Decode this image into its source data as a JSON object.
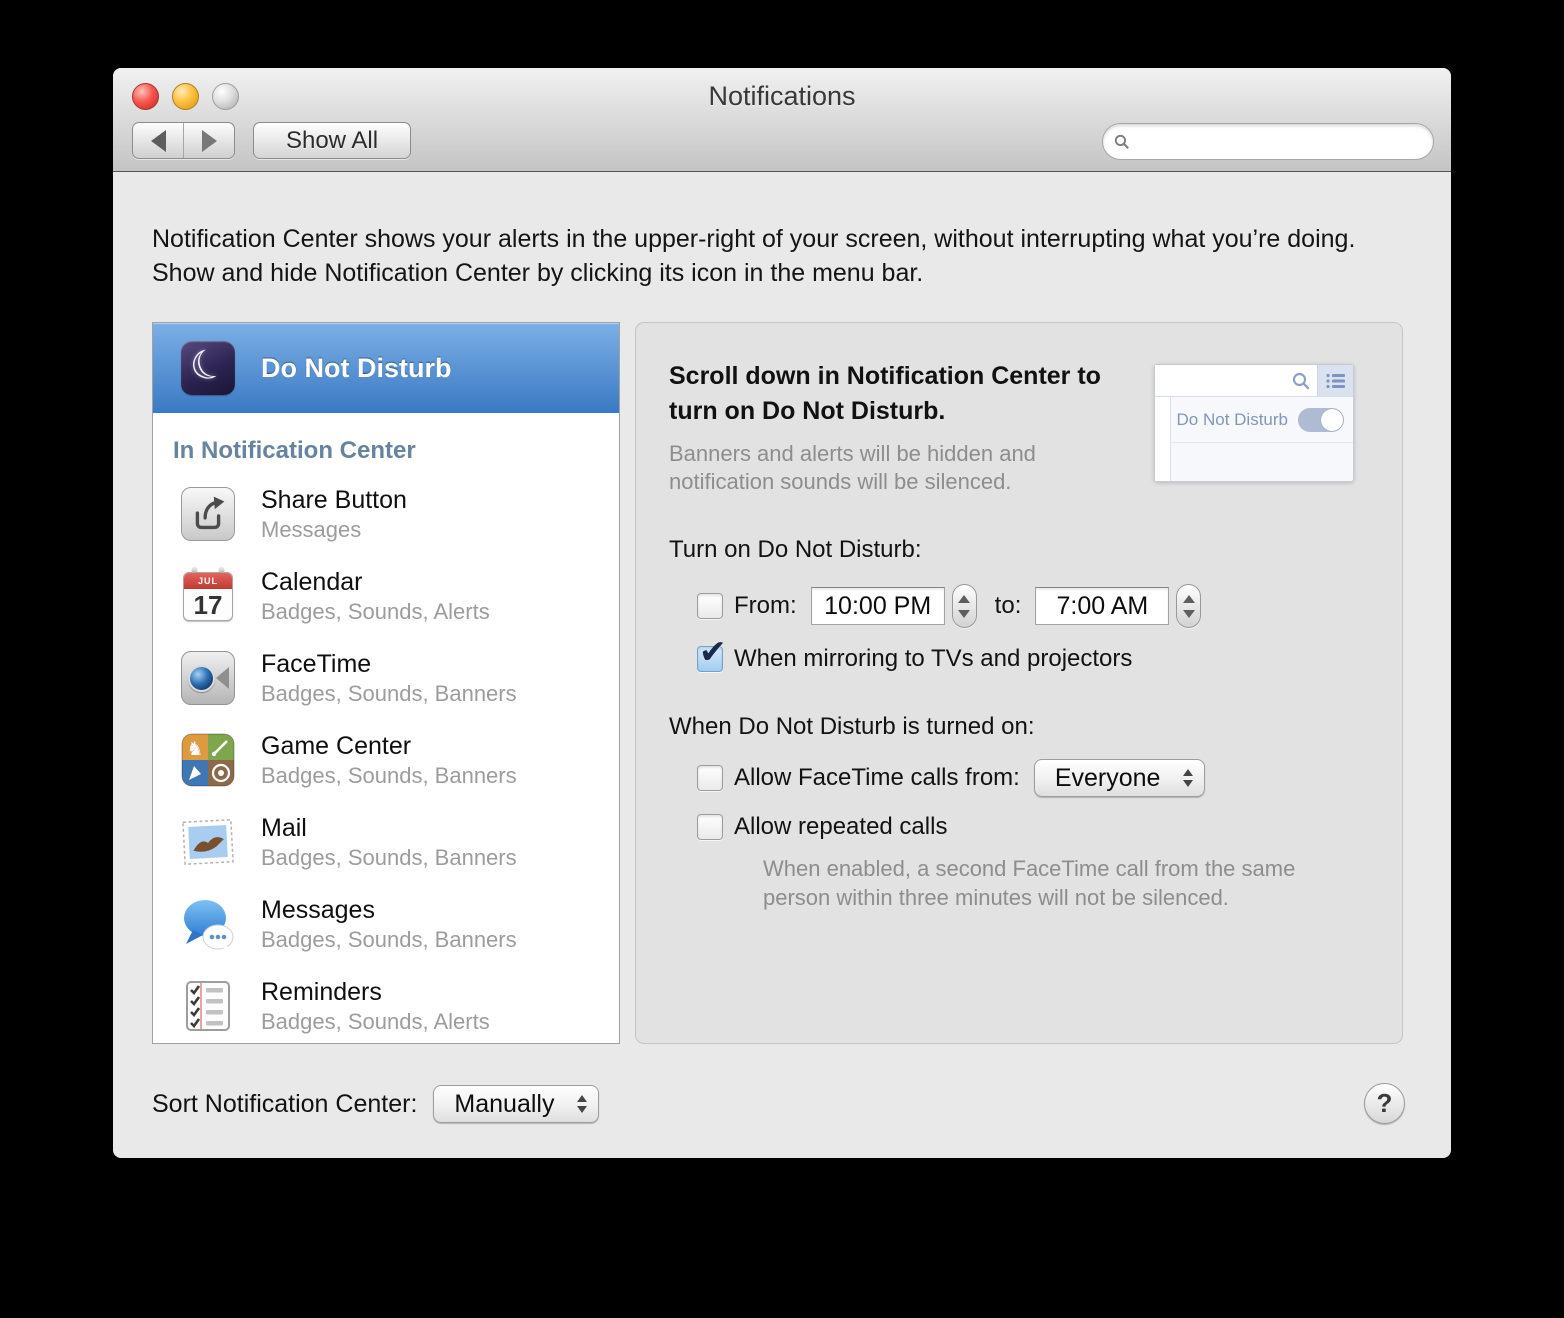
{
  "window": {
    "title": "Notifications"
  },
  "toolbar": {
    "back_label": "back",
    "forward_label": "forward",
    "show_all_label": "Show All",
    "search_value": ""
  },
  "intro": {
    "text": "Notification Center shows your alerts in the upper-right of your screen, without interrupting what you’re doing. Show and hide Notification Center by clicking its icon in the menu bar."
  },
  "sidebar": {
    "selected": {
      "label": "Do Not Disturb"
    },
    "section_header": "In Notification Center",
    "calendar_icon": {
      "month": "JUL",
      "day": "17"
    },
    "items": [
      {
        "name": "Share Button",
        "detail": "Messages"
      },
      {
        "name": "Calendar",
        "detail": "Badges, Sounds, Alerts"
      },
      {
        "name": "FaceTime",
        "detail": "Badges, Sounds, Banners"
      },
      {
        "name": "Game Center",
        "detail": "Badges, Sounds, Banners"
      },
      {
        "name": "Mail",
        "detail": "Badges, Sounds, Banners"
      },
      {
        "name": "Messages",
        "detail": "Badges, Sounds, Banners"
      },
      {
        "name": "Reminders",
        "detail": "Badges, Sounds, Alerts"
      }
    ]
  },
  "panel": {
    "headline": "Scroll down in Notification Center to turn on Do Not Disturb.",
    "subtext": "Banners and alerts will be hidden and notification sounds will be silenced.",
    "preview": {
      "dnd_label": "Do Not Disturb",
      "toggle_on": true
    },
    "turn_on": {
      "heading": "Turn on Do Not Disturb:",
      "schedule_checked": false,
      "from_label": "From:",
      "from_value": "10:00 PM",
      "to_label": "to:",
      "to_value": "7:00 AM",
      "mirroring_label": "When mirroring to TVs and projectors",
      "mirroring_checked": true
    },
    "when_on": {
      "heading": "When Do Not Disturb is turned on:",
      "facetime_label": "Allow FaceTime calls from:",
      "facetime_value": "Everyone",
      "facetime_checked": false,
      "repeated_label": "Allow repeated calls",
      "repeated_checked": false,
      "note": "When enabled, a second FaceTime call from the same person within three minutes will not be silenced."
    }
  },
  "footer": {
    "sort_label": "Sort Notification Center:",
    "sort_value": "Manually",
    "help_label": "?"
  },
  "colors": {
    "selection_blue_top": "#7cb0e6",
    "selection_blue_bottom": "#3a79c3",
    "section_header_blue": "#68839f",
    "checkbox_check_navy": "#1a2a4b",
    "window_background": "#e9e9e9",
    "panel_background": "#e2e2e2"
  }
}
